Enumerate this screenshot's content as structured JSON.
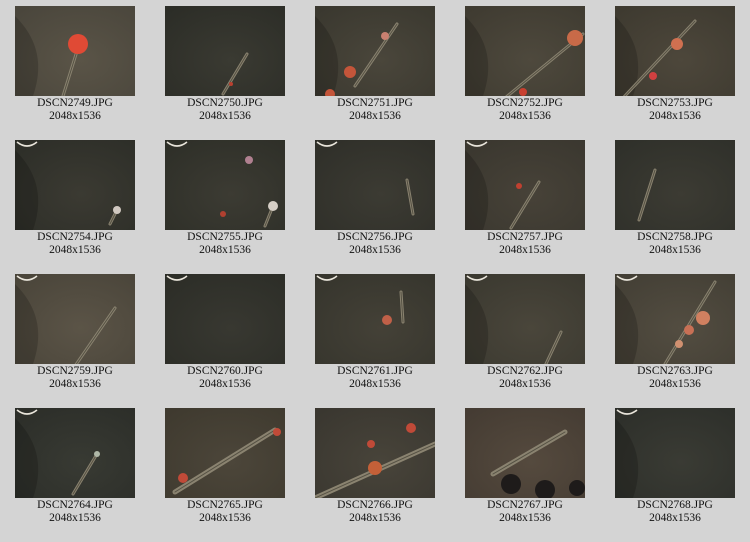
{
  "thumbnails": [
    {
      "filename": "DSCN2749.JPG",
      "dimensions": "2048x1536",
      "scene": "s2749"
    },
    {
      "filename": "DSCN2750.JPG",
      "dimensions": "2048x1536",
      "scene": "s2750"
    },
    {
      "filename": "DSCN2751.JPG",
      "dimensions": "2048x1536",
      "scene": "s2751"
    },
    {
      "filename": "DSCN2752.JPG",
      "dimensions": "2048x1536",
      "scene": "s2752"
    },
    {
      "filename": "DSCN2753.JPG",
      "dimensions": "2048x1536",
      "scene": "s2753"
    },
    {
      "filename": "DSCN2754.JPG",
      "dimensions": "2048x1536",
      "scene": "s2754"
    },
    {
      "filename": "DSCN2755.JPG",
      "dimensions": "2048x1536",
      "scene": "s2755"
    },
    {
      "filename": "DSCN2756.JPG",
      "dimensions": "2048x1536",
      "scene": "s2756"
    },
    {
      "filename": "DSCN2757.JPG",
      "dimensions": "2048x1536",
      "scene": "s2757"
    },
    {
      "filename": "DSCN2758.JPG",
      "dimensions": "2048x1536",
      "scene": "s2758"
    },
    {
      "filename": "DSCN2759.JPG",
      "dimensions": "2048x1536",
      "scene": "s2759"
    },
    {
      "filename": "DSCN2760.JPG",
      "dimensions": "2048x1536",
      "scene": "s2760"
    },
    {
      "filename": "DSCN2761.JPG",
      "dimensions": "2048x1536",
      "scene": "s2761"
    },
    {
      "filename": "DSCN2762.JPG",
      "dimensions": "2048x1536",
      "scene": "s2762"
    },
    {
      "filename": "DSCN2763.JPG",
      "dimensions": "2048x1536",
      "scene": "s2763"
    },
    {
      "filename": "DSCN2764.JPG",
      "dimensions": "2048x1536",
      "scene": "s2764"
    },
    {
      "filename": "DSCN2765.JPG",
      "dimensions": "2048x1536",
      "scene": "s2765"
    },
    {
      "filename": "DSCN2766.JPG",
      "dimensions": "2048x1536",
      "scene": "s2766"
    },
    {
      "filename": "DSCN2767.JPG",
      "dimensions": "2048x1536",
      "scene": "s2767"
    },
    {
      "filename": "DSCN2768.JPG",
      "dimensions": "2048x1536",
      "scene": "s2768"
    }
  ]
}
